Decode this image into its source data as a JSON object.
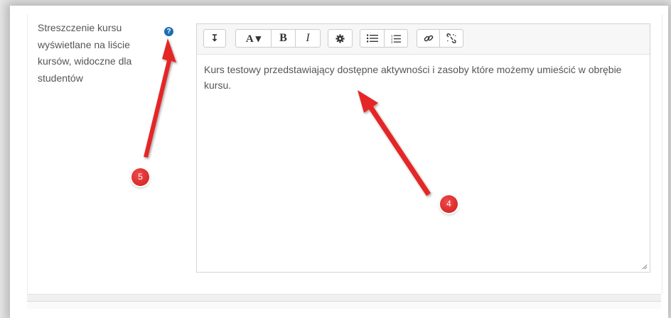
{
  "field": {
    "label": "Streszczenie kursu wyświetlane na liście kursów, widoczne dla studentów",
    "help_icon": "question-circle-icon"
  },
  "editor": {
    "toolbar": {
      "collapse_glyph": "↧",
      "font_glyph": "A ▾",
      "bold": "B",
      "italic": "I",
      "settings_icon": "gear-icon",
      "unordered_list_icon": "bullet-list-icon",
      "ordered_list_icon": "numbered-list-icon",
      "link_icon": "link-icon",
      "unlink_icon": "unlink-icon"
    },
    "content": "Kurs testowy przedstawiający dostępne aktywności i zasoby które możemy umieścić w obrębie kursu."
  },
  "annotations": {
    "badge_4": "4",
    "badge_5": "5",
    "color": "#e52525"
  }
}
